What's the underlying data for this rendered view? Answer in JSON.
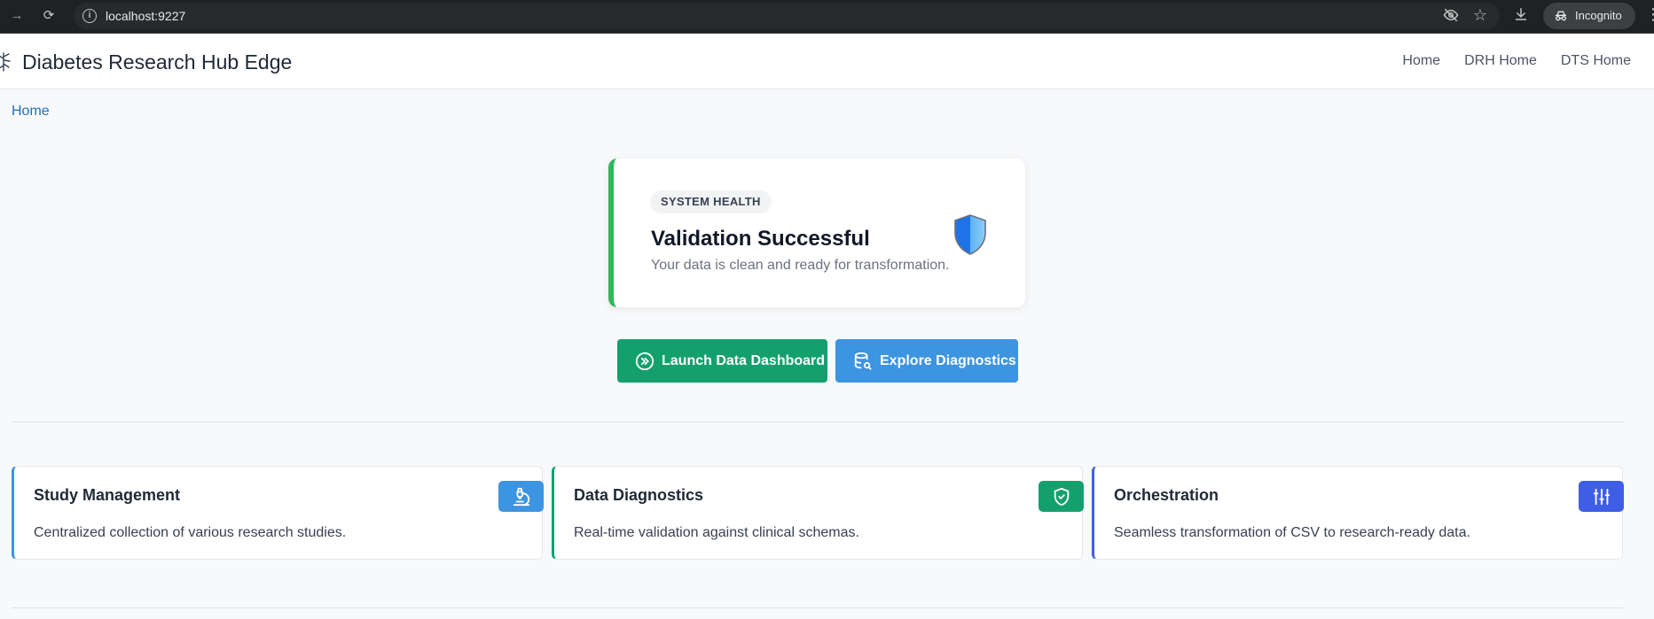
{
  "browser": {
    "url": "localhost:9227",
    "incognito_label": "Incognito"
  },
  "header": {
    "title": "Diabetes Research Hub Edge",
    "nav": [
      "Home",
      "DRH Home",
      "DTS Home"
    ]
  },
  "breadcrumb": {
    "current": "Home"
  },
  "health": {
    "badge": "SYSTEM HEALTH",
    "title": "Validation Successful",
    "message": "Your data is clean and ready for transformation.",
    "accent_color": "#2fb85a"
  },
  "actions": {
    "launch_label": "Launch Data Dashboard",
    "explore_label": "Explore Diagnostics"
  },
  "features": [
    {
      "title": "Study Management",
      "description": "Centralized collection of various research studies.",
      "icon": "microscope-icon",
      "color": "#3d94e0"
    },
    {
      "title": "Data Diagnostics",
      "description": "Real-time validation against clinical schemas.",
      "icon": "shield-check-icon",
      "color": "#14a06e"
    },
    {
      "title": "Orchestration",
      "description": "Seamless transformation of CSV to research-ready data.",
      "icon": "sliders-icon",
      "color": "#3f5ee6"
    }
  ]
}
